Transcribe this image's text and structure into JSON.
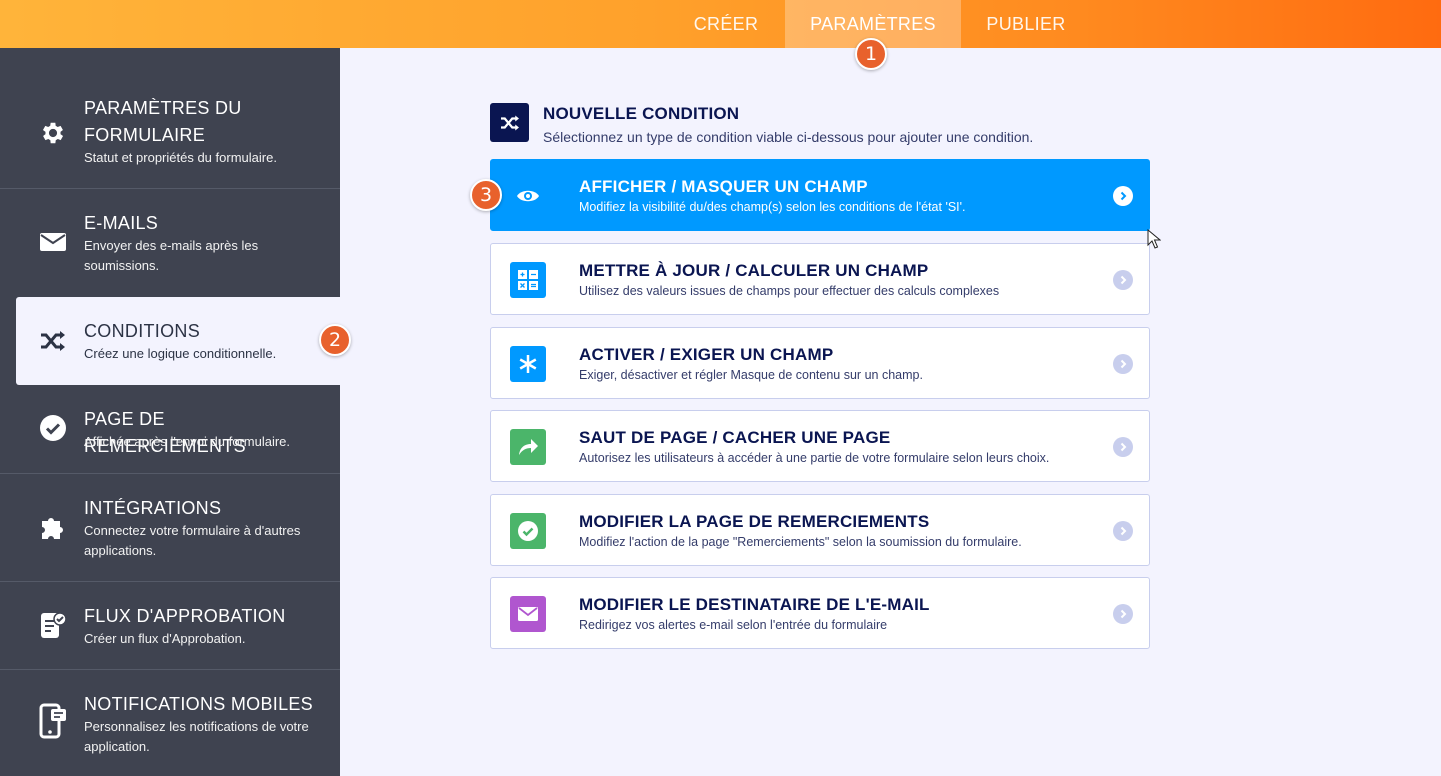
{
  "topbar": {
    "tabs": [
      {
        "label": "CRÉER"
      },
      {
        "label": "PARAMÈTRES"
      },
      {
        "label": "PUBLIER"
      }
    ]
  },
  "badges": [
    "1",
    "2",
    "3"
  ],
  "sidebar": {
    "items": [
      {
        "title_line1": "PARAMÈTRES DU",
        "title_line2": "FORMULAIRE",
        "desc": "Statut et propriétés du formulaire.",
        "icon": "gear-icon"
      },
      {
        "title": "E-MAILS",
        "desc_line1": "Envoyer des e-mails après les",
        "desc_line2": "soumissions.",
        "icon": "envelope-icon"
      },
      {
        "title": "CONDITIONS",
        "desc": "Créez une logique conditionnelle.",
        "icon": "shuffle-icon"
      },
      {
        "title": "PAGE DE REMERCIEMENTS",
        "desc": "Affichée après l'envoi du formulaire.",
        "icon": "check-circle-icon"
      },
      {
        "title": "INTÉGRATIONS",
        "desc_line1": "Connectez votre formulaire à d'autres",
        "desc_line2": "applications.",
        "icon": "puzzle-icon"
      },
      {
        "title": "FLUX D'APPROBATION",
        "desc": "Créer un flux d'Approbation.",
        "icon": "approval-doc-icon"
      },
      {
        "title": "NOTIFICATIONS MOBILES",
        "desc_line1": "Personnalisez les notifications de votre",
        "desc_line2": "application.",
        "icon": "mobile-notification-icon"
      }
    ]
  },
  "header": {
    "title": "NOUVELLE CONDITION",
    "subtitle": "Sélectionnez un type de condition viable ci-dessous pour ajouter une condition."
  },
  "conditions": [
    {
      "title": "AFFICHER / MASQUER UN CHAMP",
      "desc": "Modifiez la visibilité du/des champ(s) selon les conditions de l'état 'SI'.",
      "icon": "eye-icon",
      "color": "#0099ff"
    },
    {
      "title": "METTRE À JOUR / CALCULER UN CHAMP",
      "desc": "Utilisez des valeurs issues de champs pour effectuer des calculs complexes",
      "icon": "calculator-icon",
      "color": "#0099ff"
    },
    {
      "title": "ACTIVER / EXIGER UN CHAMP",
      "desc": "Exiger, désactiver et régler Masque de contenu sur un champ.",
      "icon": "asterisk-icon",
      "color": "#0099ff"
    },
    {
      "title": "SAUT DE PAGE / CACHER UNE PAGE",
      "desc": "Autorisez les utilisateurs à accéder à une partie de votre formulaire selon leurs choix.",
      "icon": "share-arrow-icon",
      "color": "#4bb56a"
    },
    {
      "title": "MODIFIER LA PAGE DE REMERCIEMENTS",
      "desc": "Modifiez l'action de la page \"Remerciements\" selon la soumission du formulaire.",
      "icon": "check-icon",
      "color": "#4bb56a"
    },
    {
      "title": "MODIFIER LE DESTINATAIRE DE L'E-MAIL",
      "desc": "Redirigez vos alertes e-mail selon l'entrée du formulaire",
      "icon": "envelope-icon",
      "color": "#b056cf"
    }
  ],
  "colors": {
    "accent": "#ff8a1f",
    "sidebar": "#3f4350",
    "primary": "#0099ff",
    "navy": "#0a1551",
    "badge": "#e8612c"
  }
}
